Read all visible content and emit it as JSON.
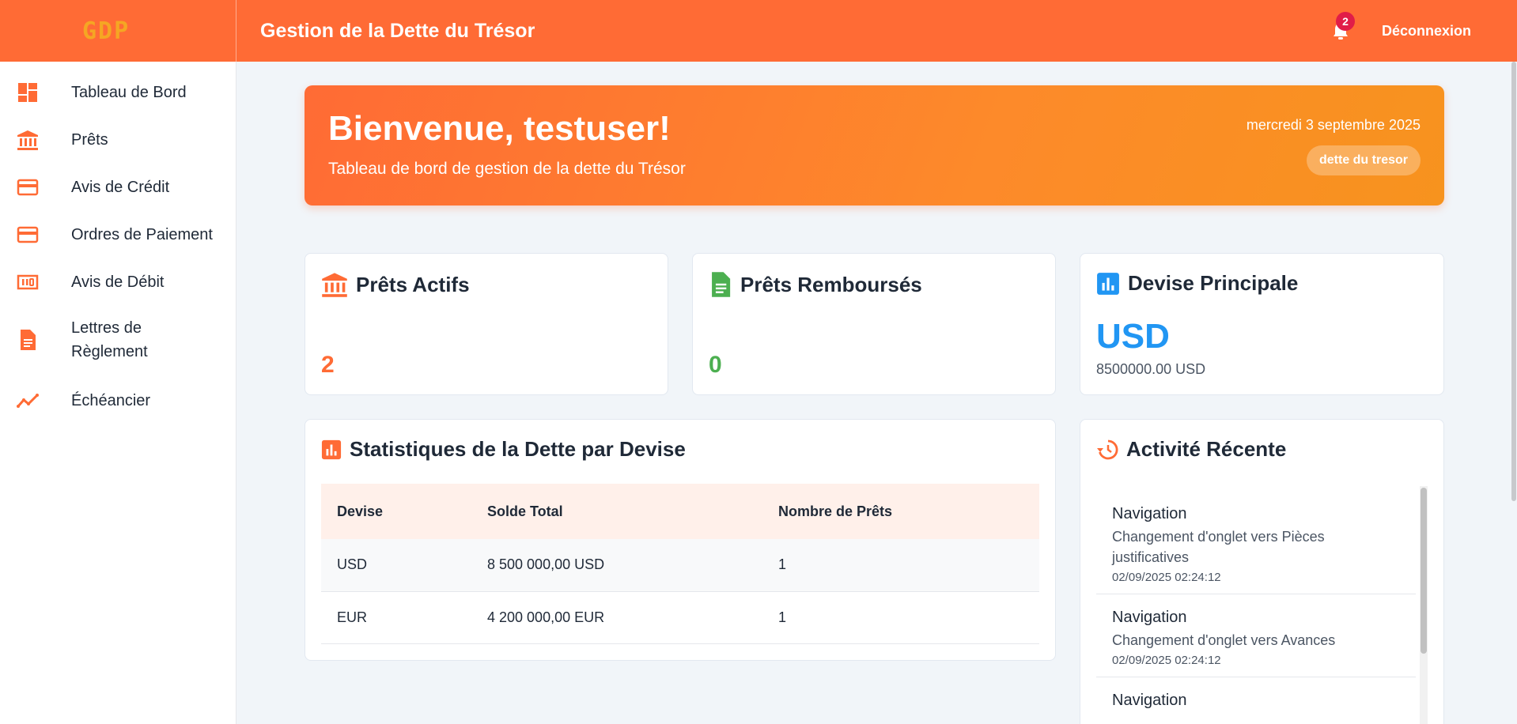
{
  "header": {
    "logo": "GDP",
    "title": "Gestion de la Dette du Trésor",
    "notification_count": "2",
    "logout_label": "Déconnexion"
  },
  "sidebar": {
    "items": [
      {
        "label": "Tableau de Bord",
        "icon": "dashboard-icon"
      },
      {
        "label": "Prêts",
        "icon": "bank-icon"
      },
      {
        "label": "Avis de Crédit",
        "icon": "credit-card-icon"
      },
      {
        "label": "Ordres de Paiement",
        "icon": "credit-card-icon"
      },
      {
        "label": "Avis de Débit",
        "icon": "money-icon"
      },
      {
        "label": "Lettres de Règlement",
        "icon": "document-icon"
      },
      {
        "label": "Échéancier",
        "icon": "trend-icon"
      }
    ]
  },
  "banner": {
    "greeting": "Bienvenue, testuser!",
    "subtitle": "Tableau de bord de gestion de la dette du Trésor",
    "date": "mercredi 3 septembre 2025",
    "pill": "dette du tresor"
  },
  "stats": {
    "active": {
      "title": "Prêts Actifs",
      "value": "2"
    },
    "repaid": {
      "title": "Prêts Remboursés",
      "value": "0"
    },
    "currency": {
      "title": "Devise Principale",
      "code": "USD",
      "amount": "8500000.00 USD"
    }
  },
  "debt_table": {
    "title": "Statistiques de la Dette par Devise",
    "columns": [
      "Devise",
      "Solde Total",
      "Nombre de Prêts"
    ],
    "rows": [
      [
        "USD",
        "8 500 000,00 USD",
        "1"
      ],
      [
        "EUR",
        "4 200 000,00 EUR",
        "1"
      ]
    ]
  },
  "activity": {
    "title": "Activité Récente",
    "items": [
      {
        "title": "Navigation",
        "desc": "Changement d'onglet vers Pièces justificatives",
        "time": "02/09/2025 02:24:12"
      },
      {
        "title": "Navigation",
        "desc": "Changement d'onglet vers Avances",
        "time": "02/09/2025 02:24:12"
      },
      {
        "title": "Navigation",
        "desc": "",
        "time": ""
      }
    ]
  },
  "colors": {
    "primary": "#ff6b35",
    "success": "#4caf50",
    "info": "#2196f3",
    "badge": "#e11d48"
  }
}
